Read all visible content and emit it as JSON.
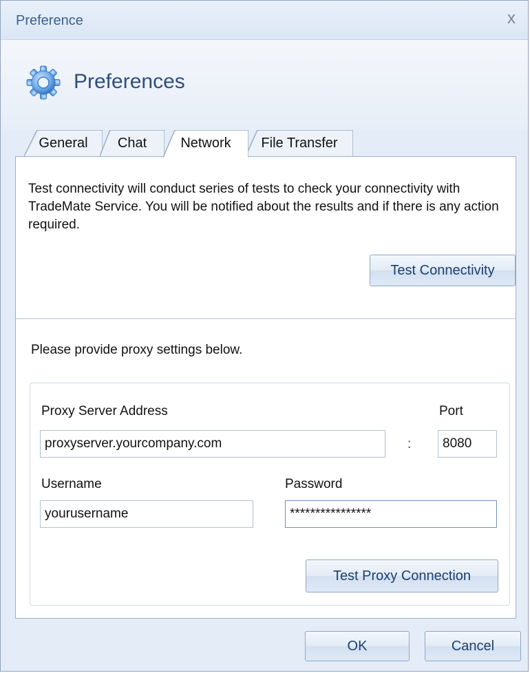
{
  "window": {
    "title": "Preference",
    "close_glyph": "x",
    "close_icon": "close-icon"
  },
  "header": {
    "icon": "gear-icon",
    "title": "Preferences",
    "accent_color": "#4a90d9"
  },
  "tabs": [
    {
      "label": "General",
      "selected": false
    },
    {
      "label": "Chat",
      "selected": false
    },
    {
      "label": "Network",
      "selected": true
    },
    {
      "label": "File Transfer",
      "selected": false
    }
  ],
  "network": {
    "description": "Test connectivity will conduct series of tests to check your connectivity with TradeMate Service. You will be notified about the results and if there is any action required.",
    "test_connectivity_label": "Test Connectivity",
    "proxy_intro": "Please provide proxy settings below.",
    "proxy": {
      "server_label": "Proxy Server Address",
      "server_value": "proxyserver.yourcompany.com",
      "colon": ":",
      "port_label": "Port",
      "port_value": "8080",
      "username_label": "Username",
      "username_value": "yourusername",
      "password_label": "Password",
      "password_value": "****************",
      "test_proxy_label": "Test Proxy Connection"
    }
  },
  "footer": {
    "ok_label": "OK",
    "cancel_label": "Cancel"
  }
}
